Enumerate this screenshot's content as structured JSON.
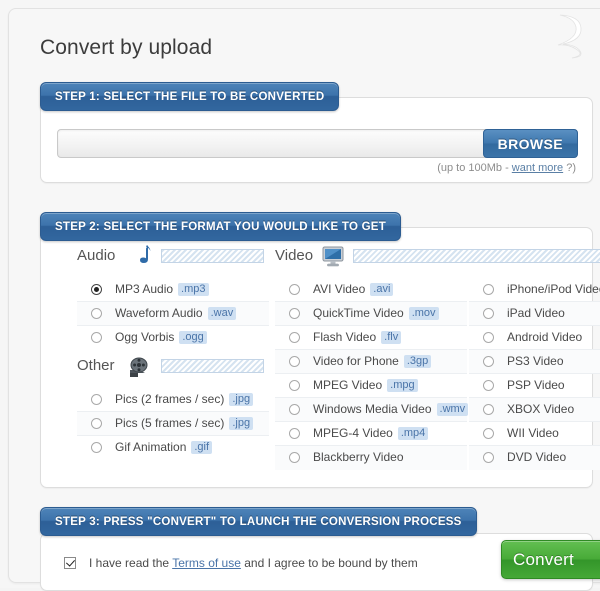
{
  "page": {
    "title": "Convert by upload"
  },
  "step1": {
    "tab_label": "STEP 1: SELECT THE FILE TO BE CONVERTED",
    "file_value": "",
    "file_placeholder": "",
    "browse_label": "BROWSE",
    "note_prefix": "(up to 100Mb - ",
    "note_link": "want more",
    "note_suffix": " ?)"
  },
  "step2": {
    "tab_label": "STEP 2: SELECT THE FORMAT YOU WOULD LIKE TO GET",
    "groups": {
      "audio": {
        "label": "Audio",
        "icon": "music-note-icon"
      },
      "video": {
        "label": "Video",
        "icon": "monitor-icon"
      },
      "other": {
        "label": "Other",
        "icon": "film-reel-icon"
      }
    },
    "audio_options": [
      {
        "label": "MP3 Audio",
        "ext": ".mp3",
        "selected": true
      },
      {
        "label": "Waveform Audio",
        "ext": ".wav",
        "selected": false
      },
      {
        "label": "Ogg Vorbis",
        "ext": ".ogg",
        "selected": false
      }
    ],
    "other_options": [
      {
        "label": "Pics (2 frames / sec)",
        "ext": ".jpg",
        "selected": false
      },
      {
        "label": "Pics (5 frames / sec)",
        "ext": ".jpg",
        "selected": false
      },
      {
        "label": "Gif Animation",
        "ext": ".gif",
        "selected": false
      }
    ],
    "video_options": [
      {
        "label": "AVI Video",
        "ext": ".avi",
        "selected": false
      },
      {
        "label": "QuickTime Video",
        "ext": ".mov",
        "selected": false
      },
      {
        "label": "Flash Video",
        "ext": ".flv",
        "selected": false
      },
      {
        "label": "Video for Phone",
        "ext": ".3gp",
        "selected": false
      },
      {
        "label": "MPEG Video",
        "ext": ".mpg",
        "selected": false
      },
      {
        "label": "Windows Media Video",
        "ext": ".wmv",
        "selected": false
      },
      {
        "label": "MPEG-4 Video",
        "ext": ".mp4",
        "selected": false
      },
      {
        "label": "Blackberry Video",
        "ext": "",
        "selected": false
      }
    ],
    "device_options": [
      {
        "label": "iPhone/iPod Video",
        "ext": "",
        "selected": false
      },
      {
        "label": "iPad Video",
        "ext": "",
        "selected": false
      },
      {
        "label": "Android Video",
        "ext": "",
        "selected": false
      },
      {
        "label": "PS3 Video",
        "ext": "",
        "selected": false
      },
      {
        "label": "PSP Video",
        "ext": "",
        "selected": false
      },
      {
        "label": "XBOX Video",
        "ext": "",
        "selected": false
      },
      {
        "label": "WII Video",
        "ext": "",
        "selected": false
      },
      {
        "label": "DVD Video",
        "ext": "",
        "selected": false
      }
    ]
  },
  "step3": {
    "tab_label": "STEP 3: PRESS \"CONVERT\" TO LAUNCH THE CONVERSION PROCESS",
    "terms_checked": true,
    "terms_prefix": "I have read the ",
    "terms_link": "Terms of use",
    "terms_suffix": " and I agree to be bound by them",
    "convert_label": "Convert"
  },
  "colors": {
    "accent_blue": "#3d73ab",
    "convert_green": "#45a837",
    "ext_badge_bg": "#cfe0f2",
    "ext_badge_text": "#4a74a8",
    "link": "#4a74a8"
  }
}
